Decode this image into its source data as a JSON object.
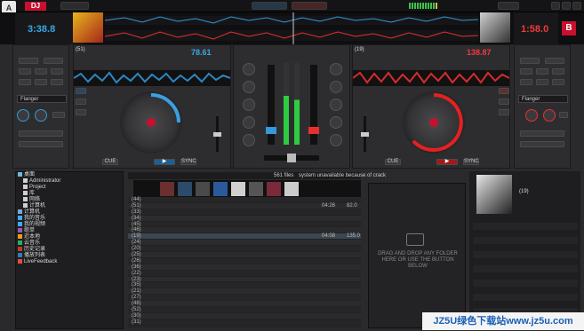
{
  "app": {
    "brand": "DJ",
    "logo_letter": "A"
  },
  "deck_left": {
    "time": "3:38.8",
    "track_num": "(51)",
    "bpm": "78.61",
    "buttons": {
      "cue": "CUE",
      "play": "▶",
      "sync": "SYNC"
    },
    "effect_select": "Flanger"
  },
  "deck_right": {
    "time": "1:58.0",
    "track_num": "(19)",
    "bpm": "138.87",
    "buttons": {
      "cue": "CUE",
      "play": "▶",
      "sync": "SYNC"
    },
    "effect_select": "Flanger",
    "deck_badge": "B"
  },
  "browser": {
    "tree": [
      {
        "label": "桌面",
        "color": "#6fb7e0"
      },
      {
        "label": "Administrator",
        "color": "#d0d0d0"
      },
      {
        "label": "Project",
        "color": "#d0d0d0"
      },
      {
        "label": "库",
        "color": "#d0d0d0"
      },
      {
        "label": "网络",
        "color": "#d0d0d0"
      },
      {
        "label": "计算机",
        "color": "#d0d0d0"
      },
      {
        "label": "计算机",
        "color": "#7aa6d8"
      },
      {
        "label": "我的音乐",
        "color": "#3fa9f5"
      },
      {
        "label": "我的视频",
        "color": "#3fa9f5"
      },
      {
        "label": "歌单",
        "color": "#9b59b6"
      },
      {
        "label": "近本地",
        "color": "#f39c12"
      },
      {
        "label": "云音乐",
        "color": "#27ae60"
      },
      {
        "label": "历史记录",
        "color": "#c0392b"
      },
      {
        "label": "播放列表",
        "color": "#2980b9"
      },
      {
        "label": "LiveFeedback",
        "color": "#e74c3c"
      }
    ],
    "status": "system unavailable because of crack",
    "file_count": "561 files",
    "rows": [
      {
        "num": "(44)",
        "time": "",
        "bpm": ""
      },
      {
        "num": "(51)",
        "time": "04:26",
        "bpm": "82.0"
      },
      {
        "num": "(33)",
        "time": "",
        "bpm": ""
      },
      {
        "num": "(34)",
        "time": "",
        "bpm": ""
      },
      {
        "num": "(45)",
        "time": "",
        "bpm": ""
      },
      {
        "num": "(46)",
        "time": "",
        "bpm": ""
      },
      {
        "num": "(19)",
        "time": "04:08",
        "bpm": "135.0"
      },
      {
        "num": "(24)",
        "time": "",
        "bpm": ""
      },
      {
        "num": "(20)",
        "time": "",
        "bpm": ""
      },
      {
        "num": "(25)",
        "time": "",
        "bpm": ""
      },
      {
        "num": "(26)",
        "time": "",
        "bpm": ""
      },
      {
        "num": "(36)",
        "time": "",
        "bpm": ""
      },
      {
        "num": "(22)",
        "time": "",
        "bpm": ""
      },
      {
        "num": "(23)",
        "time": "",
        "bpm": ""
      },
      {
        "num": "(35)",
        "time": "",
        "bpm": ""
      },
      {
        "num": "(21)",
        "time": "",
        "bpm": ""
      },
      {
        "num": "(27)",
        "time": "",
        "bpm": ""
      },
      {
        "num": "(48)",
        "time": "",
        "bpm": ""
      },
      {
        "num": "(52)",
        "time": "",
        "bpm": ""
      },
      {
        "num": "(30)",
        "time": "",
        "bpm": ""
      },
      {
        "num": "(31)",
        "time": "",
        "bpm": ""
      }
    ],
    "drop_text": "DRAG AND DROP ANY FOLDER HERE OR USE THE BUTTON BELOW"
  },
  "sidebar": {
    "item": "(19)"
  },
  "watermark": "JZ5U绿色下载站www.jz5u.com"
}
